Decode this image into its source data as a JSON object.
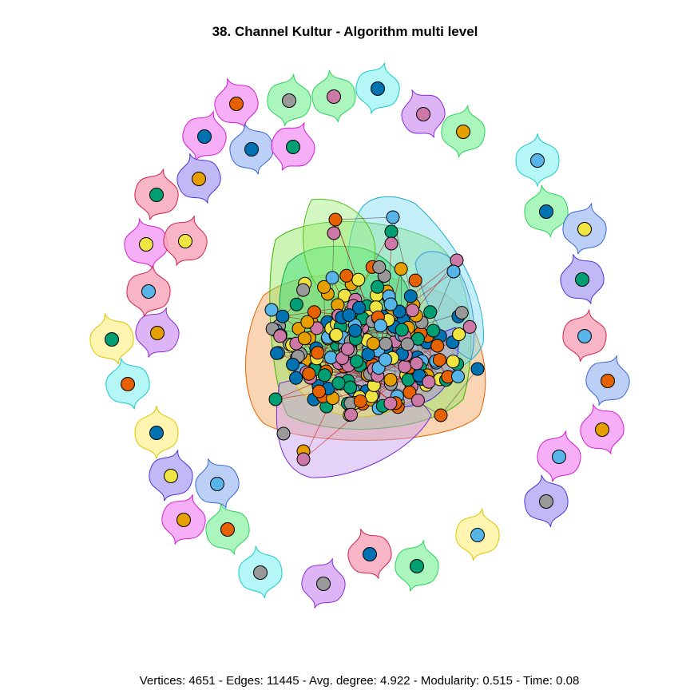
{
  "title": "38. Channel Kultur - Algorithm multi level",
  "footer": "Vertices: 4651 - Edges: 11445 - Avg. degree: 4.922 - Modularity: 0.515 - Time: 0.08",
  "node_colors": [
    "#e66100",
    "#009e73",
    "#0072b2",
    "#56b4e9",
    "#f0e442",
    "#999999",
    "#cc79a7",
    "#e69f00"
  ],
  "hull_palette": [
    {
      "fill": "#9bf5b0",
      "stroke": "#2bd15a"
    },
    {
      "fill": "#f4a0f4",
      "stroke": "#d11fd1"
    },
    {
      "fill": "#f7a8bb",
      "stroke": "#d3204d"
    },
    {
      "fill": "#b0c8f6",
      "stroke": "#3a68d6"
    },
    {
      "fill": "#b6adf3",
      "stroke": "#4a35d6"
    },
    {
      "fill": "#fff3a3",
      "stroke": "#e0c300"
    },
    {
      "fill": "#a8f4f4",
      "stroke": "#19c9c9"
    },
    {
      "fill": "#d7a8f4",
      "stroke": "#8a2bd3"
    }
  ]
}
